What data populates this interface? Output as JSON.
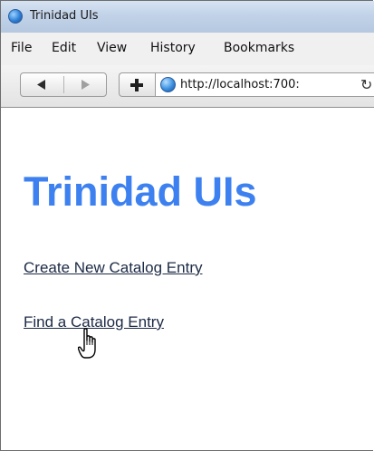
{
  "window": {
    "title": "Trinidad UIs",
    "icon": "browser-globe-icon"
  },
  "menubar": {
    "items": [
      "File",
      "Edit",
      "View",
      "History",
      "Bookmarks"
    ]
  },
  "navbar": {
    "back_icon": "back-arrow-icon",
    "forward_icon": "forward-arrow-icon",
    "new_tab_icon": "plus-icon",
    "url": "http://localhost:700:",
    "reload_icon": "reload-icon"
  },
  "page": {
    "heading": "Trinidad UIs",
    "links": [
      "Create New Catalog Entry",
      "Find a Catalog Entry"
    ],
    "heading_color": "#3d81f0"
  },
  "cursor": "hand-pointer-icon"
}
